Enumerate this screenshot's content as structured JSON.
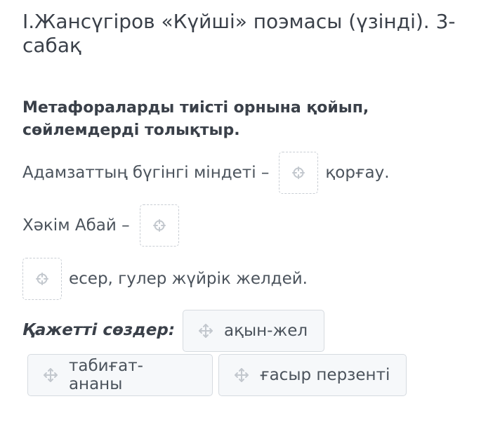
{
  "title": "І.Жансүгіров «Күйші» поэмасы (үзінді). 3-сабақ",
  "instruction": "Метафораларды тиісті орнына қойып, сөйлемдерді толықтыр.",
  "sentences": [
    {
      "before": "Адамзаттың бүгінгі міндеті –",
      "after": "қорғау."
    },
    {
      "before": "Хәкім Абай –",
      "after": ""
    },
    {
      "before": "",
      "after": "есер, гулер жүйрік желдей."
    }
  ],
  "words_label": "Қажетті сөздер:",
  "chips": [
    "ақын-жел",
    "табиғат-ананы",
    "ғасыр перзенті"
  ],
  "icons": {
    "drop_target": "move-icon",
    "chip": "move-icon"
  },
  "colors": {
    "text": "#4b535c",
    "icon": "#c3c8ce",
    "chip_bg": "#f6f8fa"
  }
}
